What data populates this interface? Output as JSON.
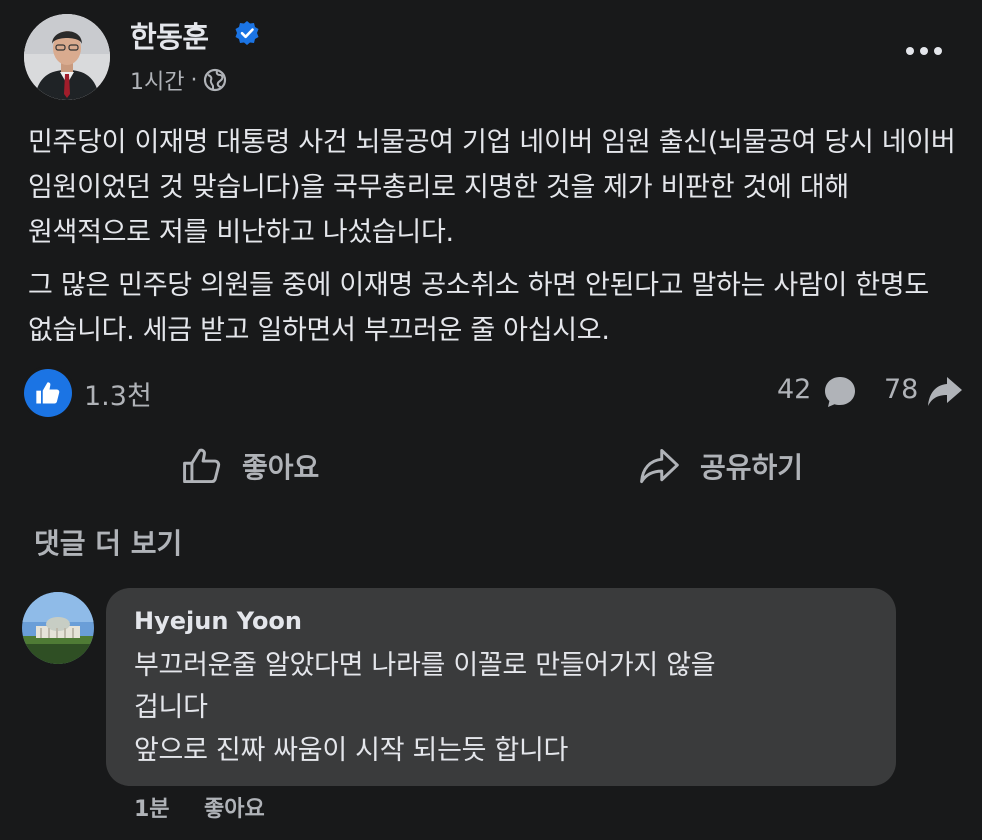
{
  "post": {
    "author": "한동훈",
    "verified_icon": "verified-badge-icon",
    "time": "1시간",
    "separator": "·",
    "audience_icon": "globe-icon",
    "more_icon": "more-options-icon",
    "paragraphs": [
      "민주당이 이재명 대통령 사건 뇌물공여 기업 네이버 임원 출신(뇌물공여 당시 네이버 임원이었던 것 맞습니다)을 국무총리로 지명한 것을 제가 비판한 것에 대해 원색적으로 저를 비난하고 나섰습니다.",
      "그 많은 민주당 의원들 중에 이재명 공소취소 하면 안된다고 말하는 사람이 한명도 없습니다. 세금 받고 일하면서 부끄러운 줄 아십시오."
    ]
  },
  "stats": {
    "likes": "1.3천",
    "comments": "42",
    "shares": "78"
  },
  "actions": {
    "like_label": "좋아요",
    "share_label": "공유하기"
  },
  "comments_section": {
    "more_label": "댓글 더 보기",
    "comment": {
      "author": "Hyejun Yoon",
      "lines": [
        "부끄러운줄 알았다면 나라를 이꼴로 만들어가지 않을",
        "겁니다",
        "앞으로 진짜 싸움이 시작 되는듯 합니다"
      ],
      "time": "1분",
      "like_label": "좋아요"
    }
  },
  "colors": {
    "background": "#18191a",
    "bubble": "#3a3b3c",
    "accent": "#1b74e4",
    "primary_text": "#e4e6eb",
    "secondary_text": "#b0b3b8"
  }
}
